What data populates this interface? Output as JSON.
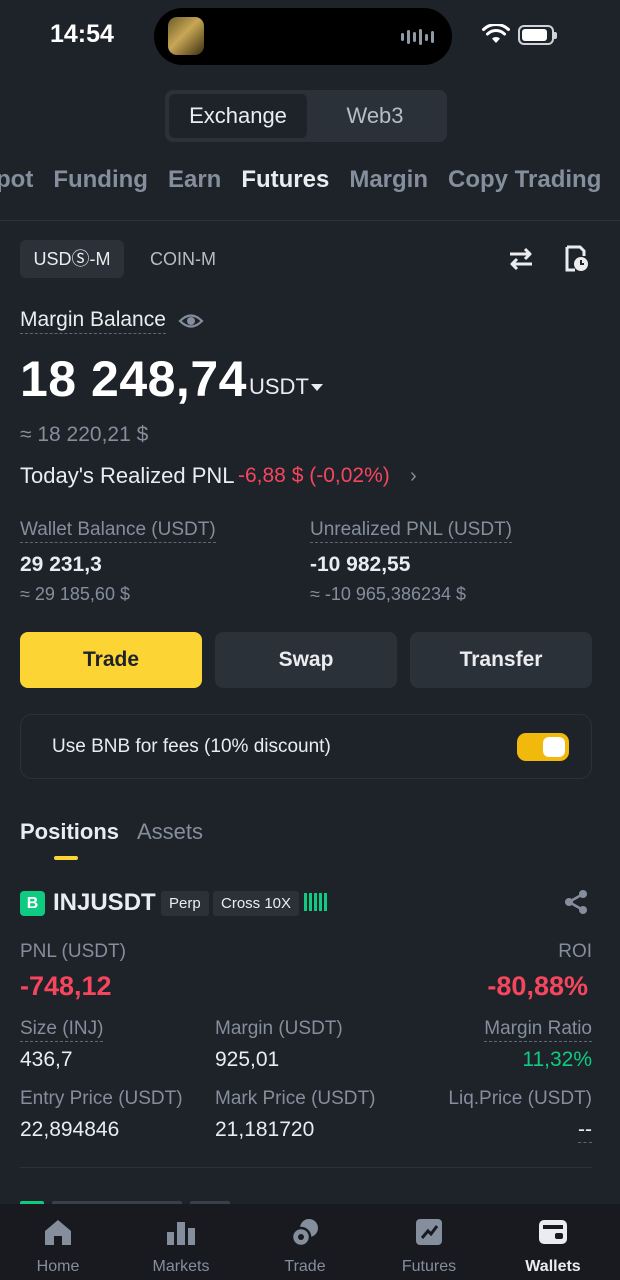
{
  "status_bar": {
    "time": "14:54"
  },
  "segment": {
    "active": "Exchange",
    "inactive": "Web3"
  },
  "top_tabs": [
    "Spot",
    "Funding",
    "Earn",
    "Futures",
    "Margin",
    "Copy Trading"
  ],
  "top_tabs_active": "Futures",
  "subtabs": {
    "usds": "USDⓈ-M",
    "coin": "COIN-M"
  },
  "margin": {
    "label": "Margin Balance",
    "amount": "18 248,74",
    "unit": "USDT",
    "approx": "≈ 18 220,21 $",
    "pnl_label": "Today's Realized PNL",
    "pnl_value": "-6,88 $ (-0,02%)"
  },
  "wallet": {
    "label": "Wallet Balance (USDT)",
    "value": "29 231,3",
    "approx": "≈ 29 185,60 $"
  },
  "unrealized": {
    "label": "Unrealized PNL (USDT)",
    "value": "-10 982,55",
    "approx": "≈ -10 965,386234 $"
  },
  "actions": {
    "trade": "Trade",
    "swap": "Swap",
    "transfer": "Transfer"
  },
  "bnb": {
    "text": "Use BNB for fees (10% discount)",
    "enabled": true
  },
  "tabs": {
    "positions": "Positions",
    "assets": "Assets"
  },
  "position": {
    "side_badge": "B",
    "symbol": "INJUSDT",
    "perp": "Perp",
    "mode": "Cross 10X",
    "pnl_label": "PNL (USDT)",
    "pnl": "-748,12",
    "roi_label": "ROI",
    "roi": "-80,88%",
    "size_label": "Size (INJ)",
    "size": "436,7",
    "margin_label": "Margin (USDT)",
    "margin": "925,01",
    "ratio_label": "Margin Ratio",
    "ratio": "11,32%",
    "entry_label": "Entry Price (USDT)",
    "entry": "22,894846",
    "mark_label": "Mark Price (USDT)",
    "mark": "21,181720",
    "liq_label": "Liq.Price (USDT)",
    "liq": "--"
  },
  "nav": [
    "Home",
    "Markets",
    "Trade",
    "Futures",
    "Wallets"
  ],
  "nav_active": "Wallets",
  "colors": {
    "accent": "#fcd535",
    "red": "#f6465d",
    "green": "#0ecb81",
    "bg": "#1e2329"
  }
}
